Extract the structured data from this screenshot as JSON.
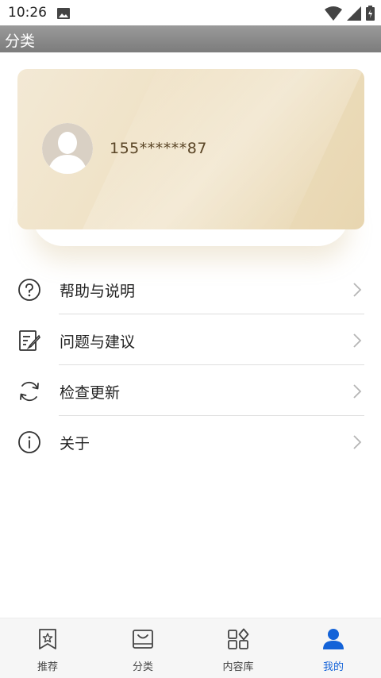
{
  "status_bar": {
    "time": "10:26"
  },
  "title_bar": {
    "title": "分类"
  },
  "profile": {
    "phone": "155******87"
  },
  "menu": {
    "items": [
      {
        "label": "帮助与说明",
        "icon": "help-icon"
      },
      {
        "label": "问题与建议",
        "icon": "feedback-icon"
      },
      {
        "label": "检查更新",
        "icon": "refresh-icon"
      },
      {
        "label": "关于",
        "icon": "info-icon"
      }
    ]
  },
  "bottom_nav": {
    "active_color": "#1463d8",
    "items": [
      {
        "label": "推荐",
        "icon": "bookmark-star-icon"
      },
      {
        "label": "分类",
        "icon": "bag-icon"
      },
      {
        "label": "内容库",
        "icon": "grid-icon"
      },
      {
        "label": "我的",
        "icon": "person-icon",
        "active": true
      }
    ]
  }
}
